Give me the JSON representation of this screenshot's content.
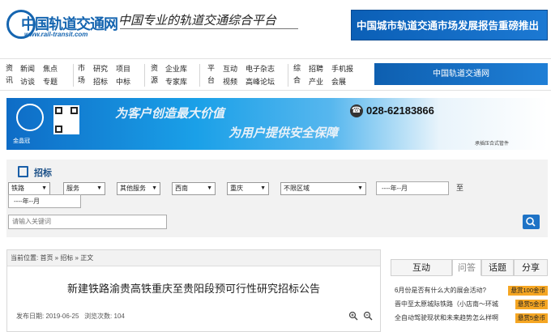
{
  "header": {
    "logo_text": "中国轨道交通网",
    "logo_url": "www.rail-transit.com",
    "slogan": "中国专业的轨道交通综合平台",
    "banner_text": "中国城市轨道交通市场发展报告重磅推出"
  },
  "nav": {
    "groups": [
      {
        "category": "资讯",
        "links": [
          "新闻",
          "焦点",
          "访谈",
          "专题"
        ]
      },
      {
        "category": "市场",
        "links": [
          "研究",
          "项目",
          "招标",
          "中标"
        ]
      },
      {
        "category": "资源",
        "links": [
          "企业库",
          "专家库"
        ]
      },
      {
        "category": "平台",
        "links": [
          "互动",
          "电子杂志",
          "视频",
          "高峰论坛"
        ]
      },
      {
        "category": "综合",
        "links": [
          "招聘",
          "手机报",
          "产业",
          "会展"
        ]
      }
    ],
    "banner_text": "中国轨道交通网"
  },
  "ad": {
    "brand": "金晶冠",
    "line1": "为客户创造最大价值",
    "line2": "为用户提供安全保障",
    "phone": "028-62183866",
    "caption": "承插压合式管件"
  },
  "filter": {
    "section_title": "招标",
    "selects": [
      "铁路",
      "服务",
      "其他服务",
      "西南",
      "重庆",
      "不限区域"
    ],
    "date_from": "----年--月",
    "to_label": "至",
    "date_to": "----年--月",
    "search_placeholder": "请输入关键词"
  },
  "article": {
    "breadcrumb": "当前位置: 首页 » 招标 » 正文",
    "title": "新建铁路渝贵高铁重庆至贵阳段预可行性研究招标公告",
    "publish_label": "发布日期:",
    "publish_date": "2019-06-25",
    "views_label": "浏览次数:",
    "views": "104"
  },
  "side": {
    "tabs": [
      "互动",
      "问答",
      "话题",
      "分享"
    ],
    "active_tab": "问答",
    "questions": [
      {
        "q": "6月份是否有什么大的展会活动?",
        "reward": "悬赏100金币"
      },
      {
        "q": "晋中至太原城际铁路（小店南～环城",
        "reward": "悬赏5金币"
      },
      {
        "q": "全自动驾驶现状和未来趋势怎么样啊",
        "reward": "悬赏5金币"
      }
    ]
  },
  "colors": {
    "brand_blue": "#1565b0",
    "reward_orange": "#f5a623",
    "search_button": "#1e73c6"
  }
}
